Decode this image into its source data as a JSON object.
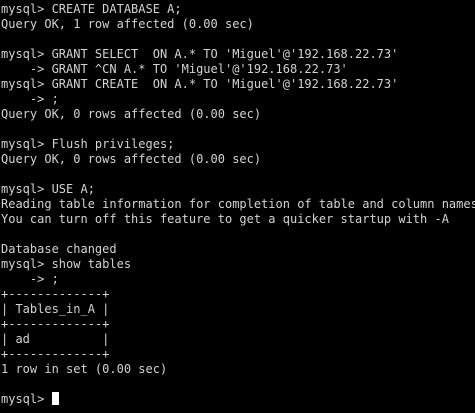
{
  "terminal": {
    "colors": {
      "background": "#000000",
      "foreground": "#d3d3d3",
      "cursor": "#ffffff"
    },
    "lines": [
      "mysql> CREATE DATABASE A;",
      "Query OK, 1 row affected (0.00 sec)",
      "",
      "mysql> GRANT SELECT  ON A.* TO 'Miguel'@'192.168.22.73'",
      "    -> GRANT ^CN A.* TO 'Miguel'@'192.168.22.73'",
      "mysql> GRANT CREATE  ON A.* TO 'Miguel'@'192.168.22.73'",
      "    -> ;",
      "Query OK, 0 rows affected (0.00 sec)",
      "",
      "mysql> Flush privileges;",
      "Query OK, 0 rows affected (0.00 sec)",
      "",
      "mysql> USE A;",
      "Reading table information for completion of table and column names",
      "You can turn off this feature to get a quicker startup with -A",
      "",
      "Database changed",
      "mysql> show tables",
      "    -> ;",
      "+-------------+",
      "| Tables_in_A |",
      "+-------------+",
      "| ad          |",
      "+-------------+",
      "1 row in set (0.00 sec)",
      ""
    ],
    "prompt": "mysql> "
  }
}
